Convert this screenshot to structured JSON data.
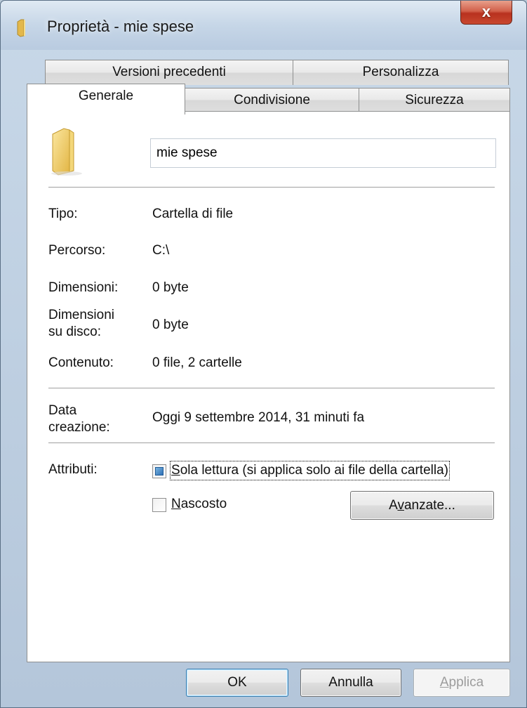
{
  "window": {
    "title": "Proprietà - mie spese",
    "close_glyph": "x"
  },
  "tabs": {
    "row_back": [
      "Versioni precedenti",
      "Personalizza"
    ],
    "row_front": [
      "Generale",
      "Condivisione",
      "Sicurezza"
    ],
    "active": "Generale"
  },
  "general": {
    "folder_name": "mie spese",
    "rows": [
      {
        "label": "Tipo:",
        "value": "Cartella di file"
      },
      {
        "label": "Percorso:",
        "value": "C:\\"
      },
      {
        "label": "Dimensioni:",
        "value": "0 byte"
      },
      {
        "label": "Dimensioni\nsu disco:",
        "value": "0 byte"
      },
      {
        "label": "Contenuto:",
        "value": "0 file, 2 cartelle"
      }
    ],
    "created_label": "Data\ncreazione:",
    "created_value": "Oggi 9 settembre 2014, 31 minuti fa",
    "attributes_label": "Attributi:",
    "readonly_label": "Sola lettura (si applica solo ai file della cartella)",
    "readonly_state": "indeterminate",
    "hidden_label": "Nascosto",
    "hidden_checked": false,
    "advanced_label": "Avanzate..."
  },
  "footer": {
    "ok": "OK",
    "cancel": "Annulla",
    "apply": "Applica"
  },
  "colors": {
    "frame": "#bfd0e2",
    "close_button": "#c9482f",
    "default_button_border": "#3c7fb1",
    "folder_yellow": "#f2cf63"
  },
  "icons": {
    "title": "folder-icon",
    "main": "folder-icon",
    "close": "close-icon"
  }
}
